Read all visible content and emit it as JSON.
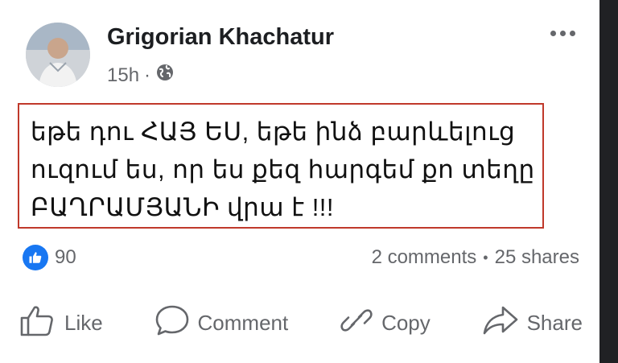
{
  "post": {
    "author": "Grigorian Khachatur",
    "time": "15h",
    "separator": "·",
    "audience_icon": "globe-icon",
    "menu_icon": "more-options-icon",
    "text": "եթե դու ՀԱՅ ԵՍ, եթե ինձ բարևելուց\nուզում ես, որ ես քեզ հարգեմ քո տեղը\nԲԱՂՐԱՄՅԱՆԻ վրա է !!!",
    "highlight_color": "#c0392b"
  },
  "stats": {
    "reactions_count": "90",
    "comments": "2 comments",
    "dot": "•",
    "shares": "25 shares"
  },
  "actions": [
    {
      "label": "Like",
      "icon": "thumbs-up-icon"
    },
    {
      "label": "Comment",
      "icon": "comment-icon"
    },
    {
      "label": "Copy",
      "icon": "link-icon"
    },
    {
      "label": "Share",
      "icon": "share-arrow-icon"
    }
  ],
  "colors": {
    "accent": "#1877f2",
    "text_secondary": "#65676b",
    "text_primary": "#1c1e21"
  }
}
